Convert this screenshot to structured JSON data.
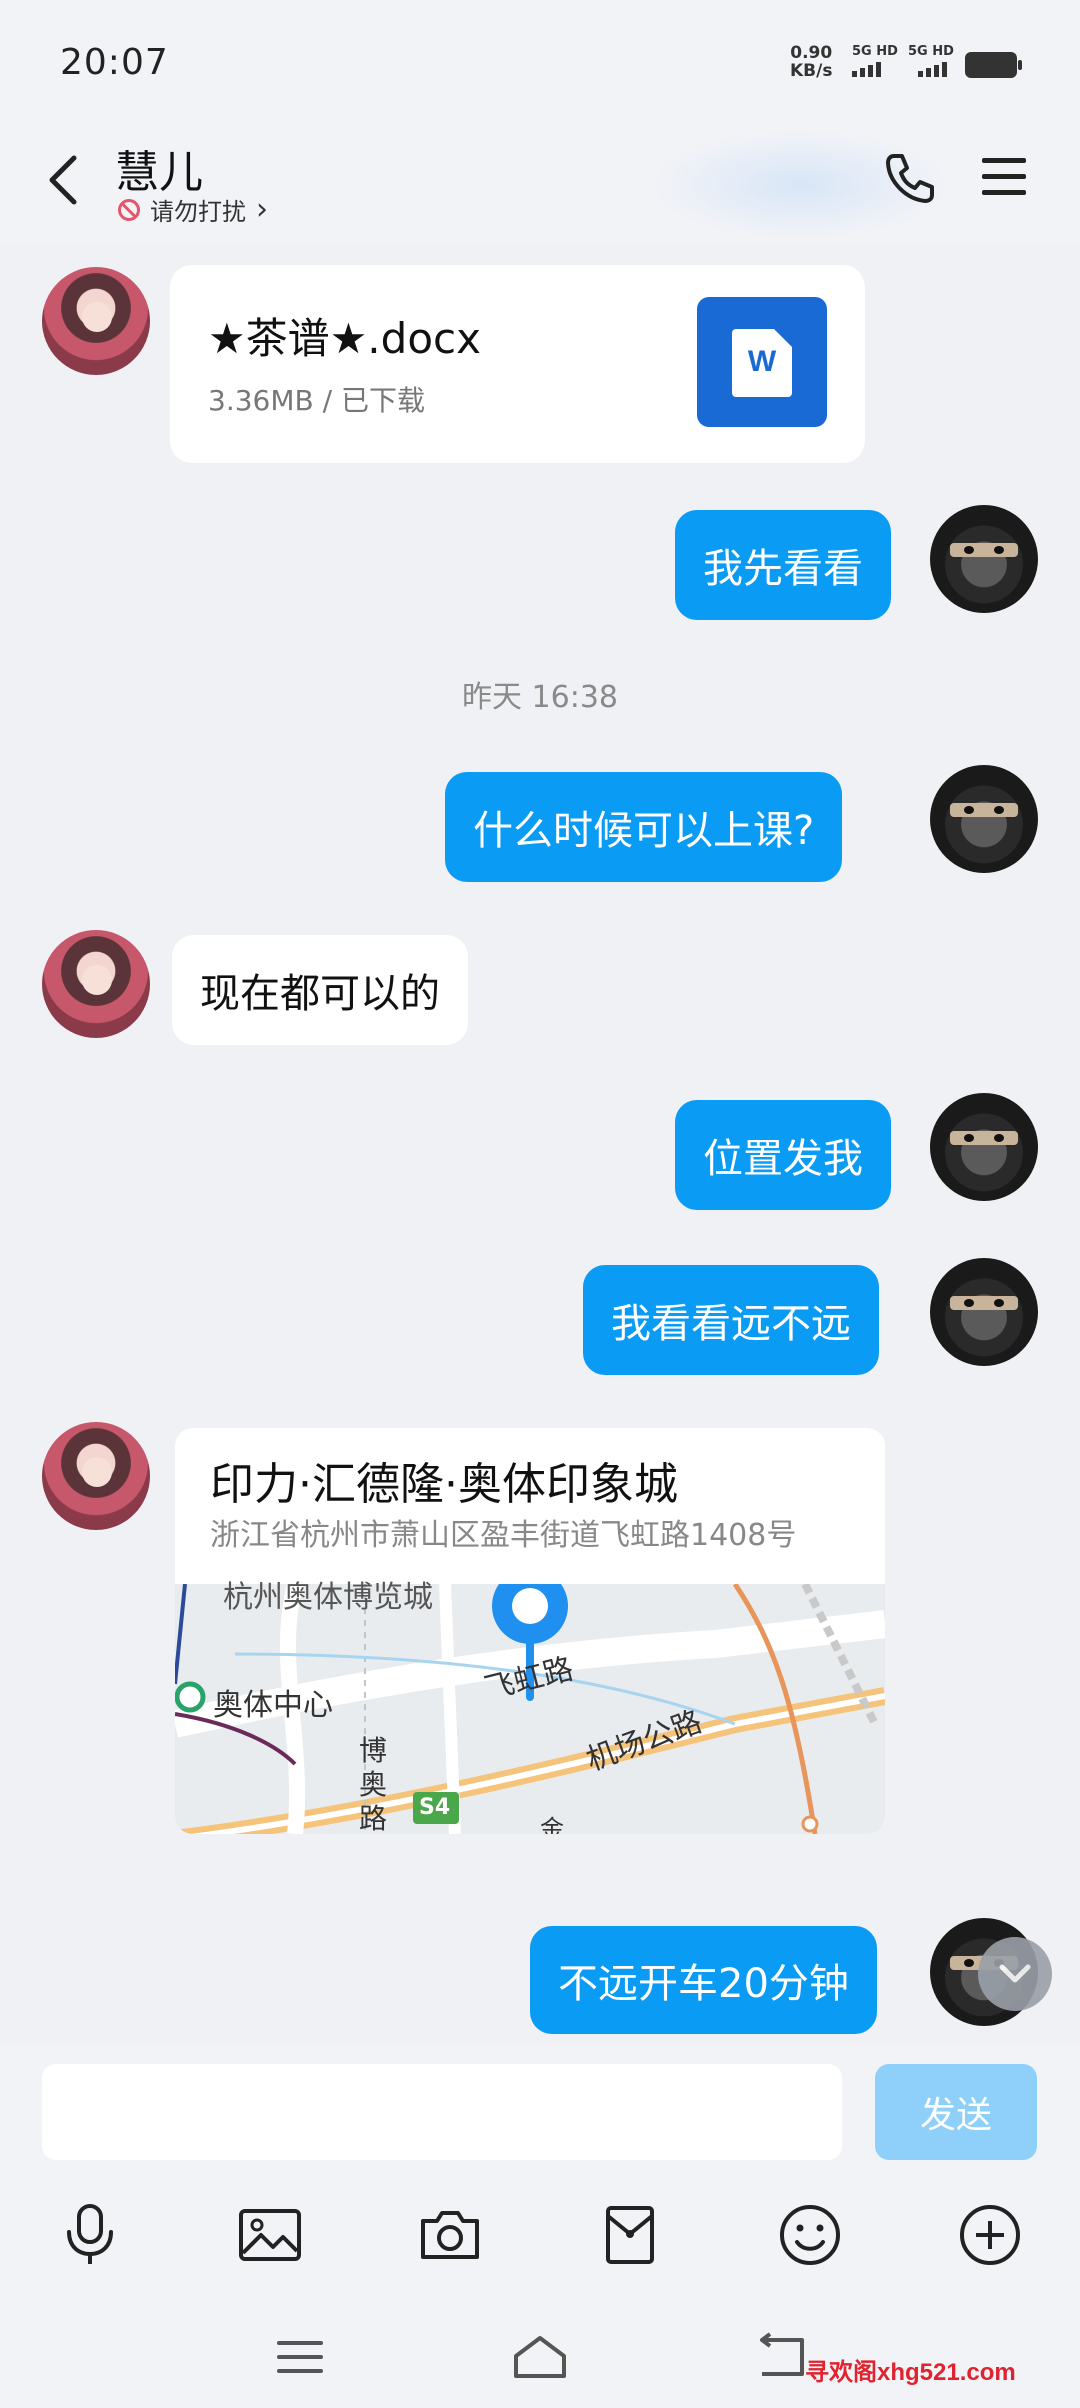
{
  "status_bar": {
    "time": "20:07",
    "net_speed_value": "0.90",
    "net_speed_unit": "KB/s",
    "sim1": "5G HD",
    "sim2": "5G HD"
  },
  "header": {
    "contact_name": "慧儿",
    "dnd_label": "请勿打扰",
    "dnd_chevron": "›",
    "icons": [
      "back-arrow-icon",
      "phone-icon",
      "menu-icon"
    ]
  },
  "messages": [
    {
      "type": "file",
      "sender": "contact",
      "file_name": "★茶谱★.docx",
      "file_meta": "3.36MB / 已下载",
      "file_icon": "W"
    },
    {
      "type": "text",
      "sender": "me",
      "text": "我先看看"
    },
    {
      "type": "timestamp",
      "text": "昨天 16:38"
    },
    {
      "type": "text",
      "sender": "me",
      "text": "什么时候可以上课?"
    },
    {
      "type": "text",
      "sender": "contact",
      "text": "现在都可以的"
    },
    {
      "type": "text",
      "sender": "me",
      "text": "位置发我"
    },
    {
      "type": "text",
      "sender": "me",
      "text": "我看看远不远"
    },
    {
      "type": "location",
      "sender": "contact",
      "title": "印力·汇德隆·奥体印象城",
      "address": "浙江省杭州市萧山区盈丰街道飞虹路1408号",
      "map_labels": {
        "top": "杭州奥体博览城",
        "center": "奥体中心",
        "road1": "飞虹路",
        "road2": "机场公路",
        "road3": "博奥路",
        "highway": "S4",
        "bottom": "金"
      }
    },
    {
      "type": "text",
      "sender": "me",
      "text": "不远开车20分钟"
    }
  ],
  "input": {
    "placeholder": "",
    "value": "",
    "send_label": "发送"
  },
  "toolbar": [
    "microphone-icon",
    "image-icon",
    "camera-icon",
    "red-packet-icon",
    "emoji-icon",
    "plus-icon"
  ],
  "watermark": "寻欢阁xhg521.com",
  "colors": {
    "bubble_out": "#0a9bf5",
    "bubble_in": "#ffffff",
    "send_disabled": "#8fd0fa",
    "background": "#f0f1f5"
  }
}
